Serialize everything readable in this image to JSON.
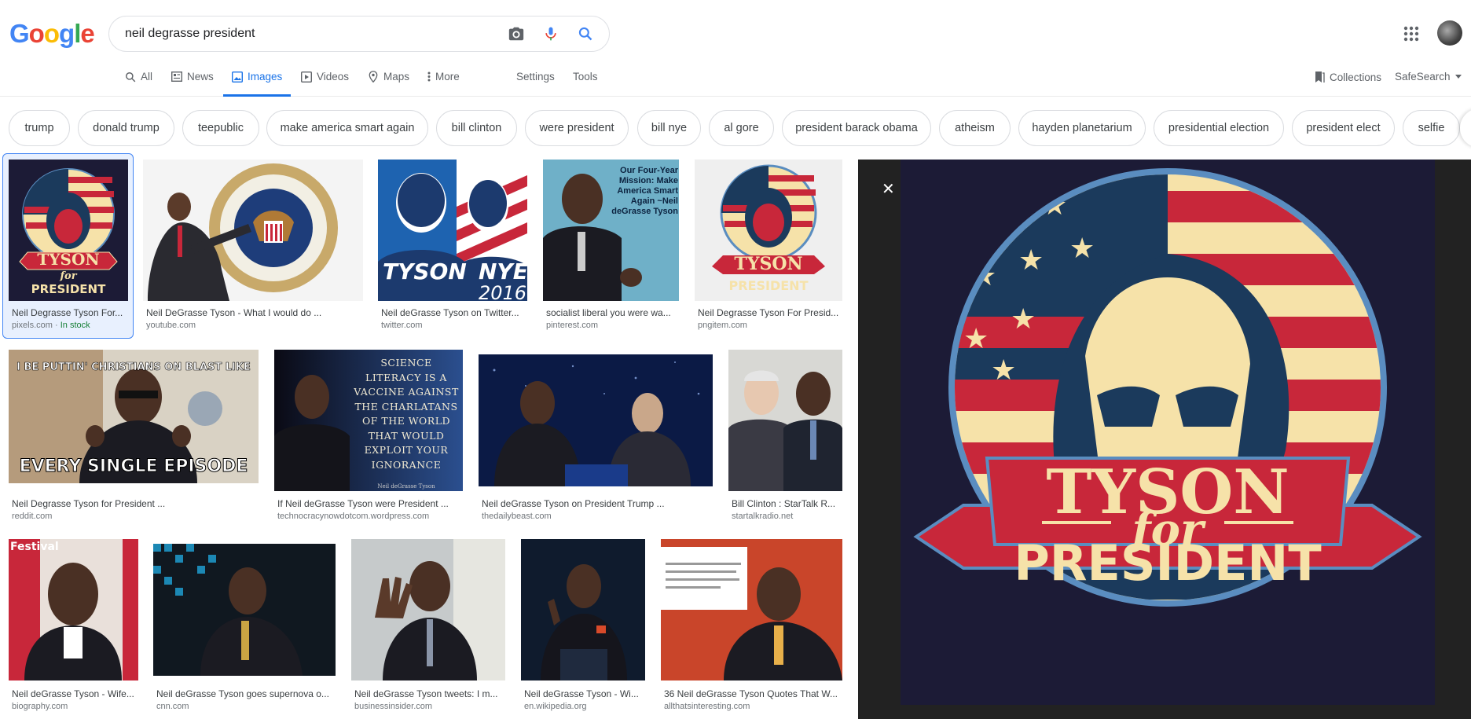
{
  "header": {
    "logo": [
      "G",
      "o",
      "o",
      "g",
      "l",
      "e"
    ],
    "logo_colors": [
      "#4285f4",
      "#ea4335",
      "#fbbc05",
      "#4285f4",
      "#34a853",
      "#ea4335"
    ],
    "query": "neil degrasse president"
  },
  "tabs": [
    {
      "label": "All",
      "icon": "search-icon"
    },
    {
      "label": "News",
      "icon": "news-icon"
    },
    {
      "label": "Images",
      "icon": "image-icon",
      "active": true
    },
    {
      "label": "Videos",
      "icon": "video-icon"
    },
    {
      "label": "Maps",
      "icon": "map-pin-icon"
    },
    {
      "label": "More",
      "icon": "more-icon"
    }
  ],
  "tools": {
    "settings": "Settings",
    "tools": "Tools",
    "collections": "Collections",
    "safesearch": "SafeSearch"
  },
  "chips": [
    "trump",
    "donald trump",
    "teepublic",
    "make america smart again",
    "bill clinton",
    "were president",
    "bill nye",
    "al gore",
    "president barack obama",
    "atheism",
    "hayden planetarium",
    "presidential election",
    "president elect",
    "selfie"
  ],
  "results": [
    {
      "title": "Neil Degrasse Tyson For...",
      "source": "pixels.com",
      "badge": "In stock"
    },
    {
      "title": "Neil DeGrasse Tyson - What I would do ...",
      "source": "youtube.com"
    },
    {
      "title": "Neil deGrasse Tyson on Twitter...",
      "source": "twitter.com"
    },
    {
      "title": "socialist liberal you were wa...",
      "source": "pinterest.com"
    },
    {
      "title": "Neil Degrasse Tyson For Presid...",
      "source": "pngitem.com"
    },
    {
      "title": "Neil Degrasse Tyson for President ...",
      "source": "reddit.com"
    },
    {
      "title": "If Neil deGrasse Tyson were President ...",
      "source": "technocracynowdotcom.wordpress.com"
    },
    {
      "title": "Neil deGrasse Tyson on President Trump ...",
      "source": "thedailybeast.com"
    },
    {
      "title": "Bill Clinton : StarTalk R...",
      "source": "startalkradio.net"
    },
    {
      "title": "Neil deGrasse Tyson - Wife...",
      "source": "biography.com"
    },
    {
      "title": "Neil deGrasse Tyson goes supernova o...",
      "source": "cnn.com"
    },
    {
      "title": "Neil deGrasse Tyson tweets: I m...",
      "source": "businessinsider.com"
    },
    {
      "title": "Neil deGrasse Tyson - Wi...",
      "source": "en.wikipedia.org"
    },
    {
      "title": "36 Neil deGrasse Tyson Quotes That W...",
      "source": "allthatsinteresting.com"
    }
  ],
  "thumb_text": {
    "t1_line1": "TYSON",
    "t1_line2": "for",
    "t1_line3": "PRESIDENT",
    "t3_line1": "TYSON",
    "t3_line2": "NYE",
    "t3_line3": "2016",
    "t4_text": "Our Four-Year Mission: Make America Smart Again ~Neil deGrasse Tyson",
    "t5_line1": "TYSON",
    "t5_line2": "PRESIDENT",
    "t6_top": "I BE PUTTIN' CHRISTIANS ON BLAST LIKE",
    "t6_bottom": "EVERY SINGLE EPISODE",
    "t7_text": "SCIENCE LITERACY IS A VACCINE AGAINST THE CHARLATANS OF THE WORLD THAT WOULD EXPLOIT YOUR IGNORANCE",
    "t7_sig": "Neil deGrasse Tyson",
    "t10_text": "Festival"
  },
  "preview": {
    "line1": "TYSON",
    "line2": "for",
    "line3": "PRESIDENT",
    "colors": {
      "cream": "#f6e2a9",
      "red": "#c8273a",
      "navy": "#1b3a5c",
      "blue": "#5a8dc0",
      "bg": "#1c1b36"
    }
  }
}
